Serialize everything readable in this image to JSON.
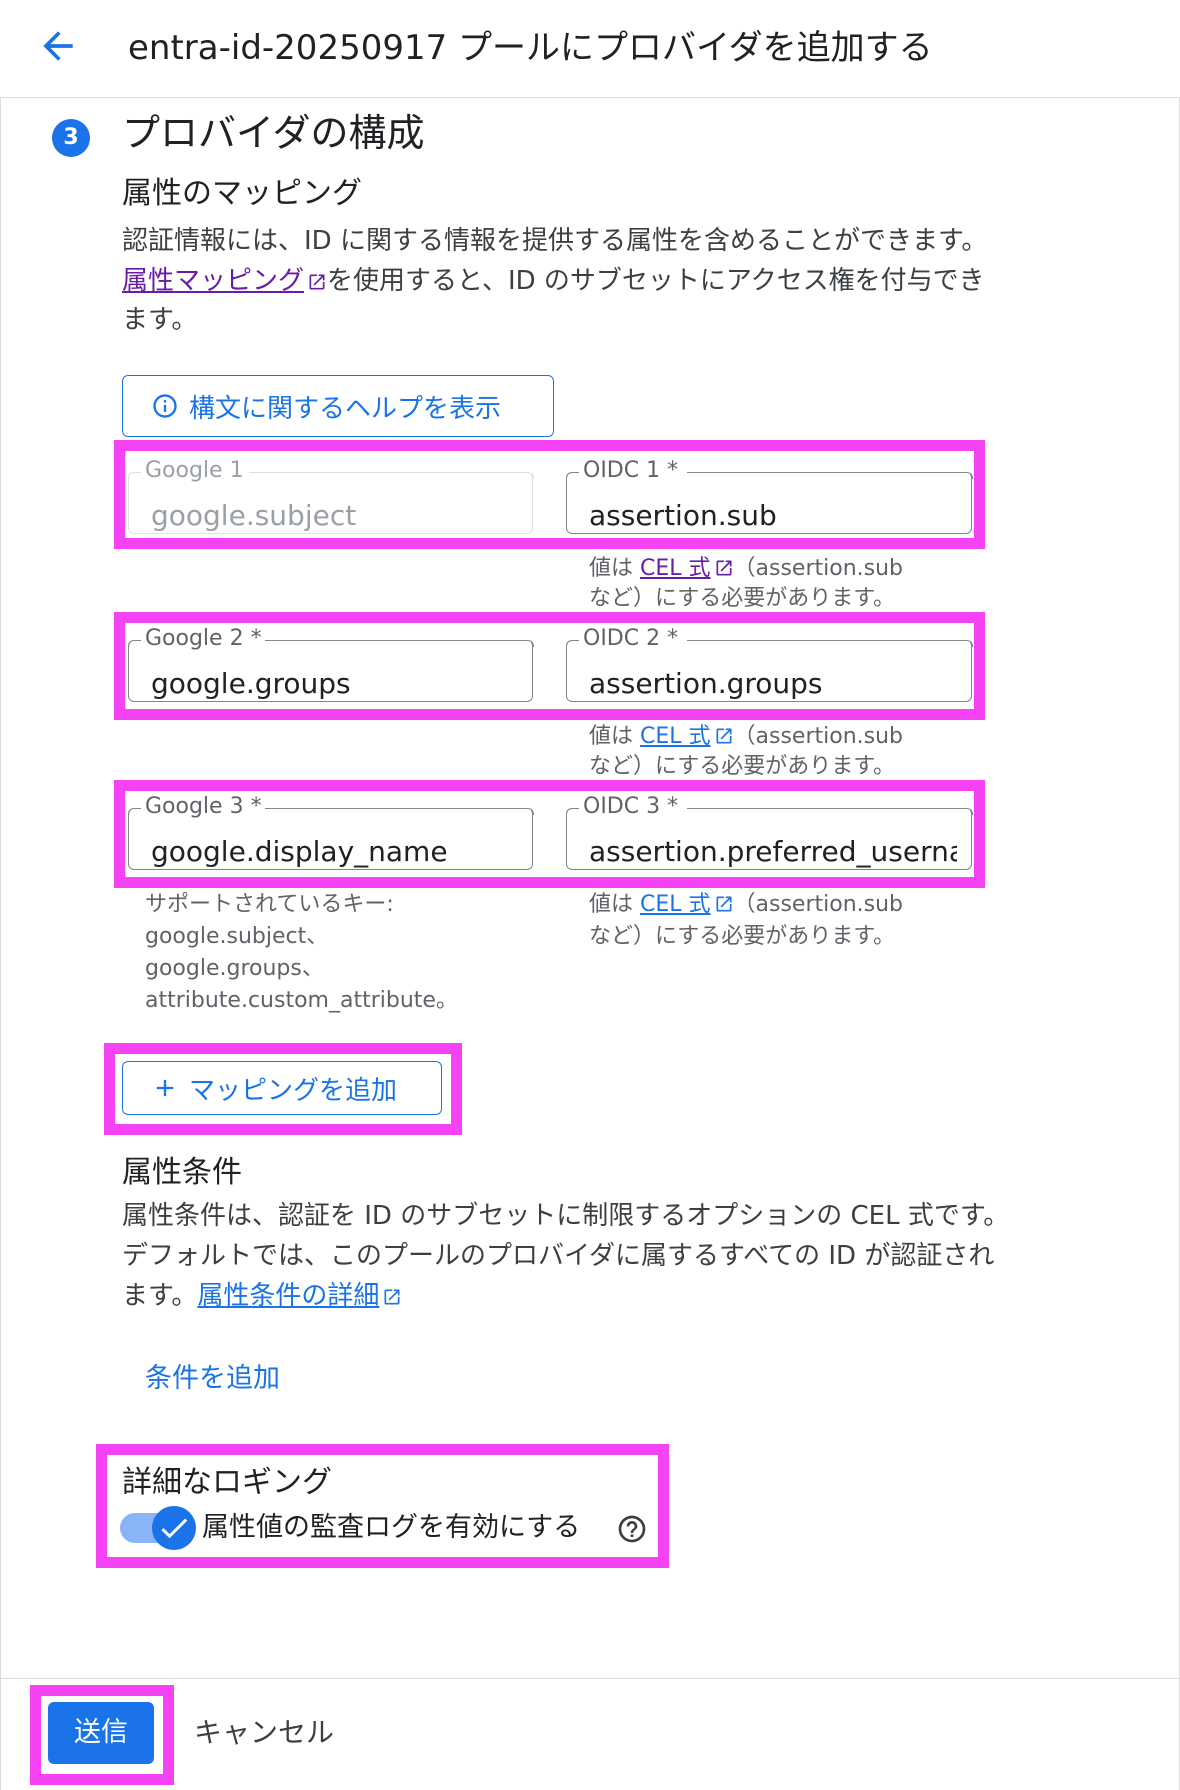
{
  "header": {
    "title": "entra-id-20250917 プールにプロバイダを追加する",
    "back_icon": "arrow-back-icon"
  },
  "step": {
    "number": "3",
    "title": "プロバイダの構成"
  },
  "attribute_mapping": {
    "heading": "属性のマッピング",
    "desc_line1": "認証情報には、ID に関する情報を提供する属性を含めることができます。",
    "desc_link": "属性マッピング",
    "desc_line2_rest": "を使用すると、ID のサブセットにアクセス権を付与でき",
    "desc_line3": "ます。",
    "syntax_help_button": "構文に関するヘルプを表示",
    "rows": [
      {
        "google_label": "Google 1",
        "google_value": "google.subject",
        "google_disabled": true,
        "oidc_label": "OIDC 1 *",
        "oidc_value": "assertion.sub"
      },
      {
        "google_label": "Google 2 *",
        "google_value": "google.groups",
        "google_disabled": false,
        "oidc_label": "OIDC 2 *",
        "oidc_value": "assertion.groups"
      },
      {
        "google_label": "Google 3 *",
        "google_value": "google.display_name",
        "google_disabled": false,
        "oidc_label": "OIDC 3 *",
        "oidc_value": "assertion.preferred_usernam"
      }
    ],
    "cel_hint_prefix": "値は",
    "cel_hint_link": "CEL 式",
    "cel_hint_line1_rest": "（assertion.sub",
    "cel_hint_line2": "など）にする必要があります。",
    "supported_keys": [
      "サポートされているキー:",
      "google.subject、",
      "google.groups、",
      "attribute.custom_attribute。"
    ],
    "add_mapping_button": "マッピングを追加"
  },
  "attribute_condition": {
    "heading": "属性条件",
    "desc_line1": "属性条件は、認証を ID のサブセットに制限するオプションの CEL 式です。",
    "desc_line2": "デフォルトでは、このプールのプロバイダに属するすべての ID が認証され",
    "desc_line3_prefix": "ます。",
    "desc_link": "属性条件の詳細",
    "add_condition_button": "条件を追加"
  },
  "logging": {
    "heading": "詳細なロギング",
    "toggle_label": "属性値の監査ログを有効にする",
    "toggle_on": true,
    "help_icon": "help-circle-icon"
  },
  "footer": {
    "submit": "送信",
    "cancel": "キャンセル"
  },
  "colors": {
    "accent": "#1a73e8",
    "highlight": "#f542f5",
    "visited_link": "#681da8"
  }
}
